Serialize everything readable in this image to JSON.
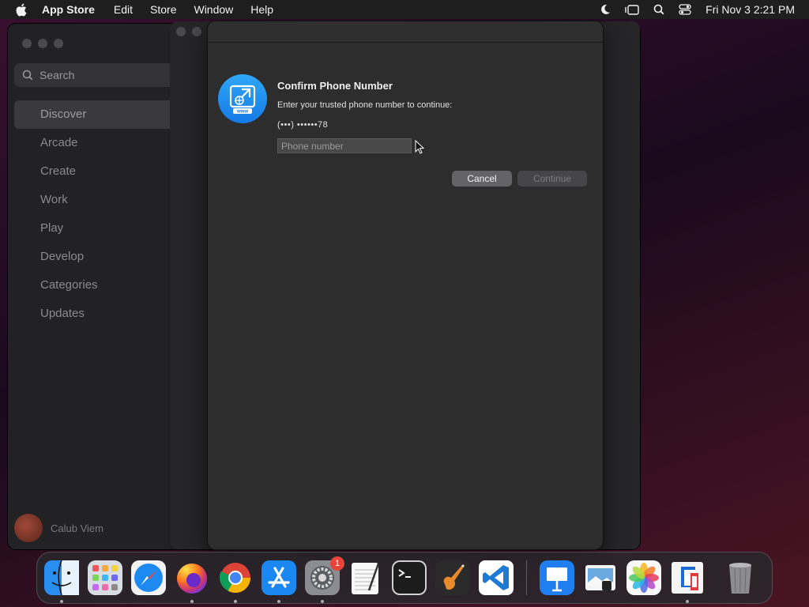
{
  "menubar": {
    "app_name": "App Store",
    "items": [
      "Edit",
      "Store",
      "Window",
      "Help"
    ],
    "clock": "Fri Nov 3  2:21 PM"
  },
  "sidebar": {
    "search_placeholder": "Search",
    "items": [
      {
        "label": "Discover",
        "active": true
      },
      {
        "label": "Arcade"
      },
      {
        "label": "Create"
      },
      {
        "label": "Work"
      },
      {
        "label": "Play"
      },
      {
        "label": "Develop"
      },
      {
        "label": "Categories"
      },
      {
        "label": "Updates"
      }
    ],
    "user_name": "Calub Viem"
  },
  "dialog": {
    "title": "Confirm Phone Number",
    "subtitle": "Enter your trusted phone number to continue:",
    "masked_number": "(•••) ••••••78",
    "input_placeholder": "Phone number",
    "input_value": "",
    "cancel_label": "Cancel",
    "continue_label": "Continue"
  },
  "dock": {
    "items": [
      {
        "name": "finder",
        "icon": "finder-icon",
        "running": true
      },
      {
        "name": "launchpad",
        "icon": "launchpad-icon",
        "running": false
      },
      {
        "name": "safari",
        "icon": "safari-icon",
        "running": false
      },
      {
        "name": "firefox",
        "icon": "firefox-icon",
        "running": true
      },
      {
        "name": "chrome",
        "icon": "chrome-icon",
        "running": true
      },
      {
        "name": "app-store",
        "icon": "app-store-icon",
        "running": true
      },
      {
        "name": "system-settings",
        "icon": "gear-icon",
        "running": true,
        "badge": "1"
      },
      {
        "name": "textedit",
        "icon": "textedit-icon",
        "running": false
      },
      {
        "name": "terminal",
        "icon": "terminal-icon",
        "running": false
      },
      {
        "name": "garageband",
        "icon": "garageband-icon",
        "running": false
      },
      {
        "name": "vscode",
        "icon": "vscode-icon",
        "running": false
      },
      {
        "name": "keynote",
        "icon": "keynote-icon",
        "running": false
      },
      {
        "name": "preview",
        "icon": "preview-icon",
        "running": false
      },
      {
        "name": "photos",
        "icon": "photos-icon",
        "running": false
      },
      {
        "name": "app-store-window",
        "icon": "window-thumbnail-icon",
        "running": true
      },
      {
        "name": "trash",
        "icon": "trash-icon",
        "running": false
      }
    ]
  },
  "colors": {
    "accent_blue": "#1a88f0",
    "dialog_bg": "#2d2d2d",
    "badge_red": "#e5443a"
  }
}
